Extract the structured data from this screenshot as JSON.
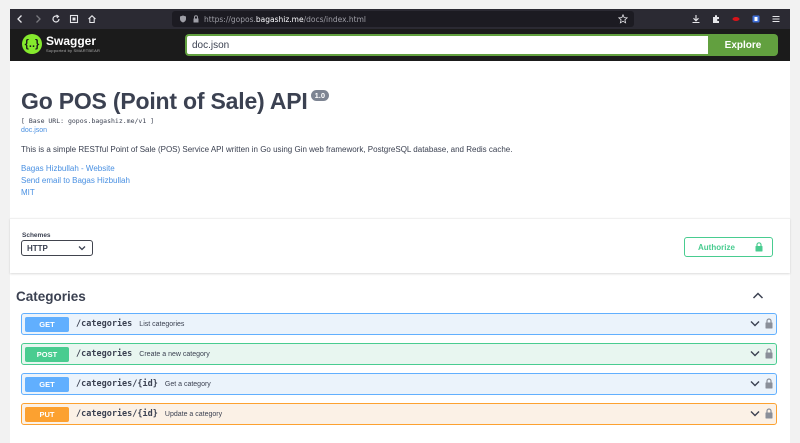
{
  "browser": {
    "url_prefix": "https://gopos.",
    "url_domain": "bagashiz.me",
    "url_suffix": "/docs/index.html"
  },
  "topbar": {
    "logo_title": "Swagger",
    "logo_sub": "Supported by SMARTBEAR",
    "spec_url": "doc.json",
    "explore_label": "Explore"
  },
  "info": {
    "title": "Go POS (Point of Sale) API",
    "version": "1.0",
    "base_url": "[ Base URL: gopos.bagashiz.me/v1 ]",
    "doc_link": "doc.json",
    "description": "This is a simple RESTful Point of Sale (POS) Service API written in Go using Gin web framework, PostgreSQL database, and Redis cache.",
    "website_link": "Bagas Hizbullah - Website",
    "email_link": "Send email to Bagas Hizbullah",
    "license": "MIT"
  },
  "schemes": {
    "label": "Schemes",
    "selected": "HTTP"
  },
  "authorize_label": "Authorize",
  "tag": {
    "name": "Categories",
    "operations": [
      {
        "method": "GET",
        "path": "/categories",
        "summary": "List categories"
      },
      {
        "method": "POST",
        "path": "/categories",
        "summary": "Create a new category"
      },
      {
        "method": "GET",
        "path": "/categories/{id}",
        "summary": "Get a category"
      },
      {
        "method": "PUT",
        "path": "/categories/{id}",
        "summary": "Update a category"
      }
    ]
  },
  "colors": {
    "get": "#61affe",
    "post": "#49cc90",
    "put": "#fca130",
    "swagger_green": "#85ea2d",
    "explore_green": "#62a03f"
  }
}
